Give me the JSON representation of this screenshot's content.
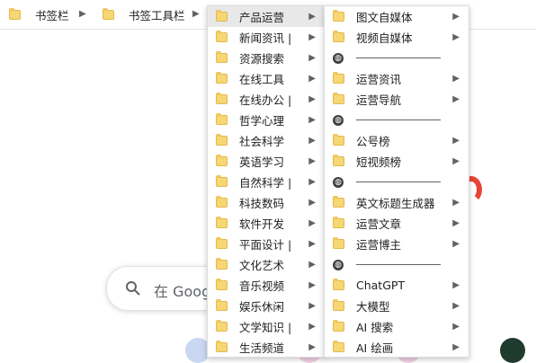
{
  "bookmarks_bar": {
    "items": [
      {
        "label": "书签栏"
      },
      {
        "label": "书签工具栏"
      }
    ]
  },
  "background": {
    "search_placeholder": "在 Goog"
  },
  "menu_level1": {
    "items": [
      {
        "label": "产品运营",
        "active": true
      },
      {
        "label": "新闻资讯 |"
      },
      {
        "label": "资源搜索"
      },
      {
        "label": "在线工具"
      },
      {
        "label": "在线办公 |"
      },
      {
        "label": "哲学心理"
      },
      {
        "label": "社会科学"
      },
      {
        "label": "英语学习"
      },
      {
        "label": "自然科学 |"
      },
      {
        "label": "科技数码"
      },
      {
        "label": "软件开发"
      },
      {
        "label": "平面设计 |"
      },
      {
        "label": "文化艺术"
      },
      {
        "label": "音乐视频"
      },
      {
        "label": "娱乐休闲"
      },
      {
        "label": "文学知识 |"
      },
      {
        "label": "生活频道"
      }
    ]
  },
  "menu_level2": {
    "items": [
      {
        "type": "folder",
        "label": "图文自媒体"
      },
      {
        "type": "folder",
        "label": "视频自媒体"
      },
      {
        "type": "separator"
      },
      {
        "type": "folder",
        "label": "运营资讯"
      },
      {
        "type": "folder",
        "label": "运营导航"
      },
      {
        "type": "separator"
      },
      {
        "type": "folder",
        "label": "公号榜"
      },
      {
        "type": "folder",
        "label": "短视频榜"
      },
      {
        "type": "separator"
      },
      {
        "type": "folder",
        "label": "英文标题生成器"
      },
      {
        "type": "folder",
        "label": "运营文章"
      },
      {
        "type": "folder",
        "label": "运营博主"
      },
      {
        "type": "separator"
      },
      {
        "type": "folder",
        "label": "ChatGPT"
      },
      {
        "type": "folder",
        "label": "大模型"
      },
      {
        "type": "folder",
        "label": "AI 搜索"
      },
      {
        "type": "folder",
        "label": "AI 绘画"
      }
    ]
  },
  "icons": {
    "folder": "folder-icon",
    "globe": "globe-icon",
    "submenu": "chevron-right-icon",
    "search": "search-icon"
  },
  "colors": {
    "folder": "#f7d774",
    "google_red": "#ea4335",
    "active_row": "#e8e8e8"
  }
}
